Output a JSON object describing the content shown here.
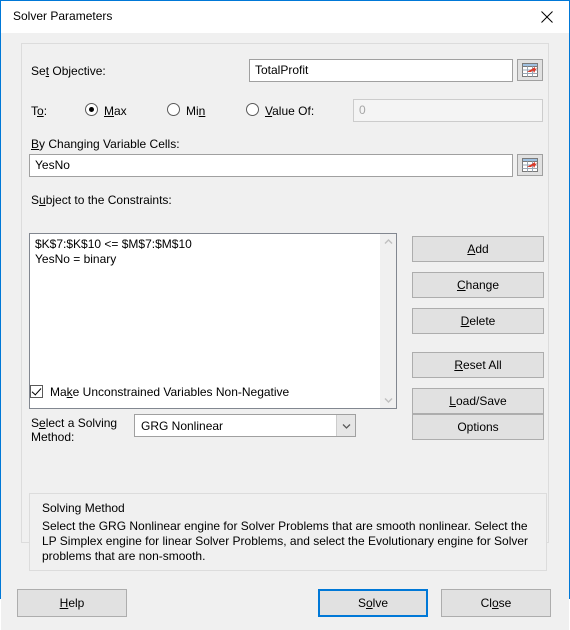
{
  "window": {
    "title": "Solver Parameters",
    "close_icon": "close-icon",
    "border_color": "#0078d7"
  },
  "objective": {
    "label": "Set Objective:",
    "label_accel": "t",
    "value": "TotalProfit",
    "range_picker_icon": "range-select-icon"
  },
  "to": {
    "label": "To:",
    "options": [
      {
        "label": "Max",
        "accel": "M",
        "selected": true
      },
      {
        "label": "Min",
        "accel": "n",
        "selected": false
      },
      {
        "label": "Value Of:",
        "accel": "V",
        "selected": false
      }
    ],
    "value_of": {
      "value": "0",
      "disabled": true
    }
  },
  "variable_cells": {
    "label": "By Changing Variable Cells:",
    "value": "YesNo",
    "range_picker_icon": "range-select-icon"
  },
  "constraints": {
    "label": "Subject to the Constraints:",
    "items": [
      "$K$7:$K$10 <= $M$7:$M$10",
      "YesNo = binary"
    ],
    "scrollbar": {
      "up_icon": "chevron-up-icon",
      "down_icon": "chevron-down-icon"
    },
    "buttons": [
      {
        "name": "add",
        "label": "Add"
      },
      {
        "name": "change",
        "label": "Change"
      },
      {
        "name": "delete",
        "label": "Delete"
      },
      {
        "name": "reset-all",
        "label": "Reset All"
      },
      {
        "name": "load-save",
        "label": "Load/Save"
      }
    ]
  },
  "non_negative": {
    "label": "Make Unconstrained Variables Non-Negative",
    "checked": true
  },
  "solving_method": {
    "label_line1": "Select a Solving",
    "label_line2": "Method:",
    "selected": "GRG Nonlinear",
    "dropdown_icon": "chevron-down-icon",
    "options_button": "Options"
  },
  "solving_method_info": {
    "title": "Solving Method",
    "description": "Select the GRG Nonlinear engine for Solver Problems that are smooth nonlinear. Select the LP Simplex engine for linear Solver Problems, and select the Evolutionary engine for Solver problems that are non-smooth."
  },
  "footer": {
    "help": "Help",
    "solve": "Solve",
    "close": "Close"
  }
}
